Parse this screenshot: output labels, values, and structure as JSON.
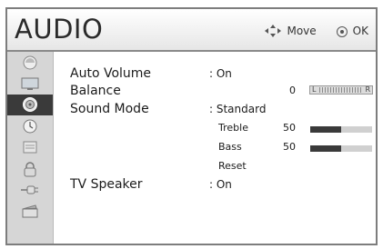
{
  "header": {
    "title": "AUDIO",
    "move_label": "Move",
    "ok_label": "OK"
  },
  "sidebar": {
    "items": [
      {
        "icon": "picture-icon",
        "active": false
      },
      {
        "icon": "tv-icon",
        "active": false
      },
      {
        "icon": "audio-icon",
        "active": true
      },
      {
        "icon": "time-icon",
        "active": false
      },
      {
        "icon": "option-icon",
        "active": false
      },
      {
        "icon": "lock-icon",
        "active": false
      },
      {
        "icon": "input-icon",
        "active": false
      },
      {
        "icon": "media-icon",
        "active": false
      }
    ]
  },
  "menu": {
    "auto_volume": {
      "label": "Auto Volume",
      "value": ": On"
    },
    "balance": {
      "label": "Balance",
      "value": "0",
      "left": "L",
      "right": "R",
      "level": 0.5
    },
    "sound_mode": {
      "label": "Sound Mode",
      "value": ": Standard"
    },
    "treble": {
      "label": "Treble",
      "value": "50",
      "level": 0.5
    },
    "bass": {
      "label": "Bass",
      "value": "50",
      "level": 0.5
    },
    "reset": {
      "label": "Reset"
    },
    "tv_speaker": {
      "label": "TV Speaker",
      "value": ": On"
    }
  },
  "colors": {
    "accent_dark": "#3a3a3a",
    "track": "#d0d0d0",
    "sidebar_bg": "#d6d6d6"
  }
}
